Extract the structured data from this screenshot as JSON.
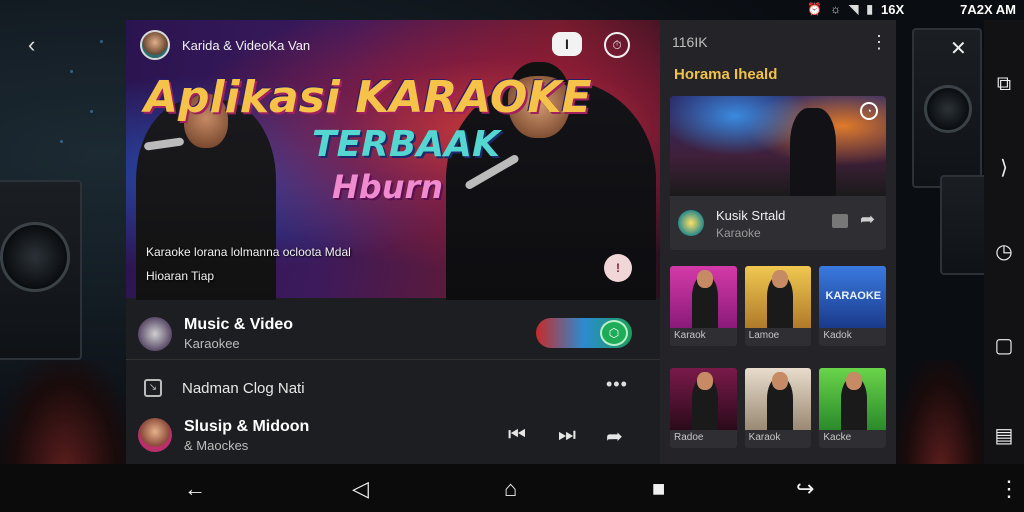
{
  "status_bar": {
    "time": "7A2X AM",
    "battery": "16X"
  },
  "header": {
    "title": "Karida & VideoKa Van",
    "pill_button": "I",
    "settings_glyph": "⏱"
  },
  "hero": {
    "headline": "Aplikasi KARAOKE",
    "subheadline": "TERBAAK",
    "tagline": "Hburn",
    "description_line1": "Karaoke lorana lolmanna ocloota Mdal",
    "description_line2": "Hioaran Tiap",
    "badge": "!"
  },
  "now_playing": {
    "title": "Music & Video",
    "subtitle": "Karaokee"
  },
  "queue_item": {
    "label": "Nadman Clog Nati"
  },
  "track": {
    "title": "Slusip & Midoon",
    "subtitle": "& Maockes"
  },
  "side": {
    "header": "116IK",
    "section_title": "Horama Iheald",
    "feature": {
      "title": "Kusik Srtald",
      "subtitle": "Karaoke"
    },
    "tiles_row1": [
      {
        "label": "Karaok",
        "bg": "#c02a9a"
      },
      {
        "label": "Lamoe",
        "bg": "#e3b23a"
      },
      {
        "label": "Kadok",
        "bg": "#2a62c8",
        "word": "KARAOKE"
      }
    ],
    "tiles_row2": [
      {
        "label": "Radoe",
        "bg": "#8a1a3a"
      },
      {
        "label": "Karaok",
        "bg": "#d1c4b0"
      },
      {
        "label": "Kacke",
        "bg": "#4cc43a"
      }
    ]
  },
  "colors": {
    "accent_yellow": "#f1c24a",
    "panel": "#1d1e22",
    "side_panel": "#242428",
    "toggle_green": "#1eac58"
  }
}
